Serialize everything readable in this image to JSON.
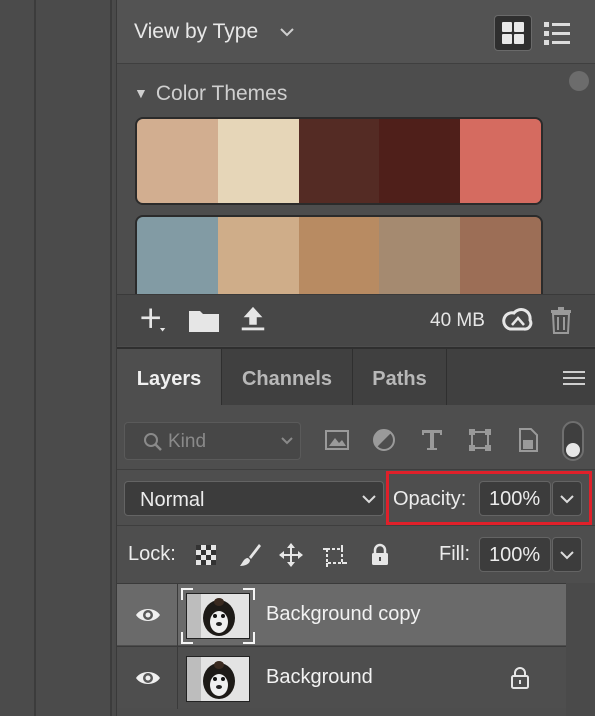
{
  "library": {
    "view_label": "View by Type",
    "themes_label": "Color Themes",
    "themes": [
      [
        "#d2ae90",
        "#e6d6b8",
        "#542b24",
        "#4f1f1a",
        "#d56b60"
      ],
      [
        "#829ba4",
        "#cfad89",
        "#b88b62",
        "#a58a70",
        "#9c6e56"
      ]
    ],
    "size_label": "40 MB",
    "icons": [
      "add-icon",
      "folder-icon",
      "upload-icon",
      "creative-cloud-icon",
      "trash-icon",
      "grid-view-icon",
      "list-view-icon"
    ]
  },
  "layers": {
    "tabs": [
      "Layers",
      "Channels",
      "Paths"
    ],
    "active_tab": "Layers",
    "filter_placeholder": "Kind",
    "blend_mode": "Normal",
    "opacity_label": "Opacity:",
    "opacity_value": "100%",
    "lock_label": "Lock:",
    "fill_label": "Fill:",
    "fill_value": "100%",
    "highlight_color": "#e0202a",
    "rows": [
      {
        "name": "Background copy",
        "selected": true,
        "locked": false
      },
      {
        "name": "Background",
        "selected": false,
        "locked": true
      }
    ]
  }
}
